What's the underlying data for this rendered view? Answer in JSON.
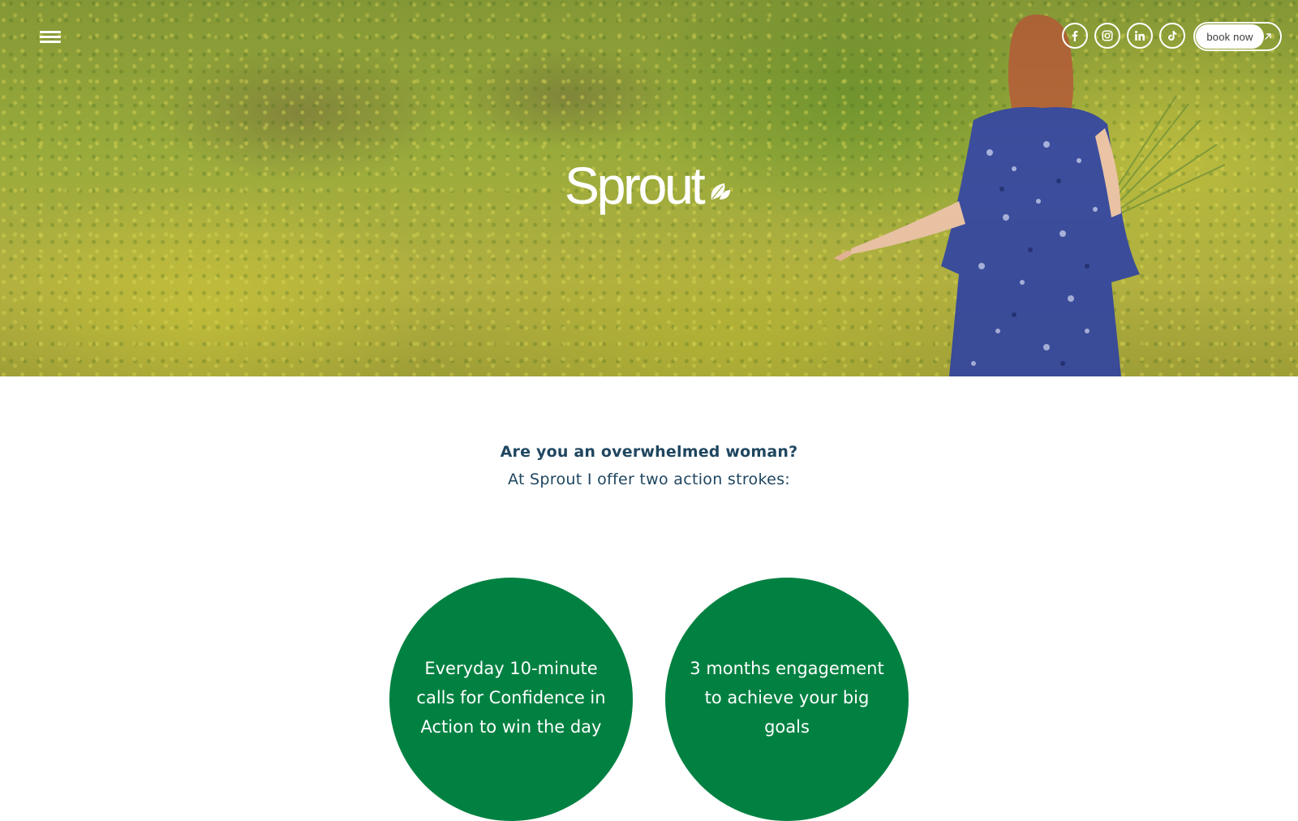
{
  "header": {
    "menu_icon": "hamburger-menu-icon",
    "social": [
      {
        "name": "facebook",
        "icon": "facebook-icon"
      },
      {
        "name": "instagram",
        "icon": "instagram-icon"
      },
      {
        "name": "linkedin",
        "icon": "linkedin-icon"
      },
      {
        "name": "tiktok",
        "icon": "tiktok-icon"
      }
    ],
    "book_label": "book now",
    "book_icon": "arrow-up-right-icon"
  },
  "hero": {
    "logo_text": "Sprout",
    "logo_icon": "leaf-icon"
  },
  "intro": {
    "question": "Are you an overwhelmed woman?",
    "subtitle": "At Sprout I offer two action strokes:"
  },
  "offers": [
    {
      "text": "Everyday 10-minute calls for Confidence in Action to win the day"
    },
    {
      "text": "3 months engagement to achieve your big goals"
    }
  ],
  "colors": {
    "brand_green": "#008141",
    "text_navy": "#1f4660",
    "white": "#ffffff"
  }
}
